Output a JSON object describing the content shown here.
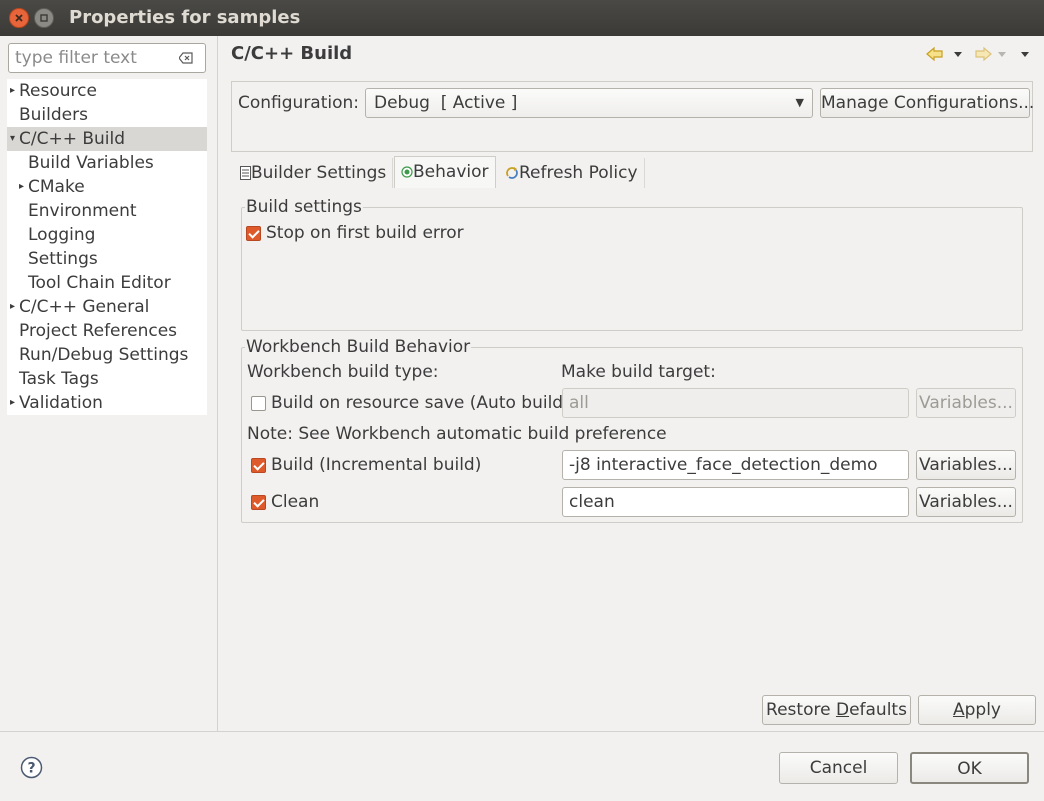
{
  "window": {
    "title": "Properties for samples"
  },
  "sidebar": {
    "filter_placeholder": "type filter text",
    "items": [
      {
        "label": "Resource",
        "expandable": true,
        "level": 0
      },
      {
        "label": "Builders",
        "expandable": false,
        "level": 0
      },
      {
        "label": "C/C++ Build",
        "expandable": true,
        "expanded": true,
        "level": 0,
        "selected": true
      },
      {
        "label": "Build Variables",
        "expandable": false,
        "level": 1
      },
      {
        "label": "CMake",
        "expandable": true,
        "level": 1
      },
      {
        "label": "Environment",
        "expandable": false,
        "level": 1
      },
      {
        "label": "Logging",
        "expandable": false,
        "level": 1
      },
      {
        "label": "Settings",
        "expandable": false,
        "level": 1
      },
      {
        "label": "Tool Chain Editor",
        "expandable": false,
        "level": 1
      },
      {
        "label": "C/C++ General",
        "expandable": true,
        "level": 0
      },
      {
        "label": "Project References",
        "expandable": false,
        "level": 0
      },
      {
        "label": "Run/Debug Settings",
        "expandable": false,
        "level": 0
      },
      {
        "label": "Task Tags",
        "expandable": false,
        "level": 0
      },
      {
        "label": "Validation",
        "expandable": true,
        "level": 0
      }
    ]
  },
  "page": {
    "title": "C/C++ Build"
  },
  "config": {
    "label": "Configuration:",
    "selected": "Debug  [ Active ]",
    "manage_label": "Manage Configurations..."
  },
  "tabs": [
    {
      "label": "Builder Settings",
      "icon": "list-icon"
    },
    {
      "label": "Behavior",
      "icon": "radio-icon",
      "active": true
    },
    {
      "label": "Refresh Policy",
      "icon": "refresh-icon"
    }
  ],
  "build_settings": {
    "legend": "Build settings",
    "stop_on_error": {
      "label": "Stop on first build error",
      "checked": true
    }
  },
  "workbench": {
    "legend": "Workbench Build Behavior",
    "type_label": "Workbench build type:",
    "target_label": "Make build target:",
    "note": "Note: See Workbench automatic build preference",
    "auto_build": {
      "label": "Build on resource save (Auto build)",
      "checked": false,
      "value": "all",
      "enabled": false
    },
    "incremental": {
      "label": "Build (Incremental build)",
      "checked": true,
      "value": "-j8 interactive_face_detection_demo"
    },
    "clean": {
      "label": "Clean",
      "checked": true,
      "value": "clean"
    },
    "variables_label": "Variables..."
  },
  "buttons": {
    "restore_prefix": "Restore ",
    "restore_mnemonic": "D",
    "restore_suffix": "efaults",
    "apply_mnemonic": "A",
    "apply_suffix": "pply",
    "cancel": "Cancel",
    "ok": "OK"
  },
  "colors": {
    "checkbox_checked": "#df5a2a",
    "close_button": "#e8643a",
    "back_arrow": "#e0b020"
  }
}
